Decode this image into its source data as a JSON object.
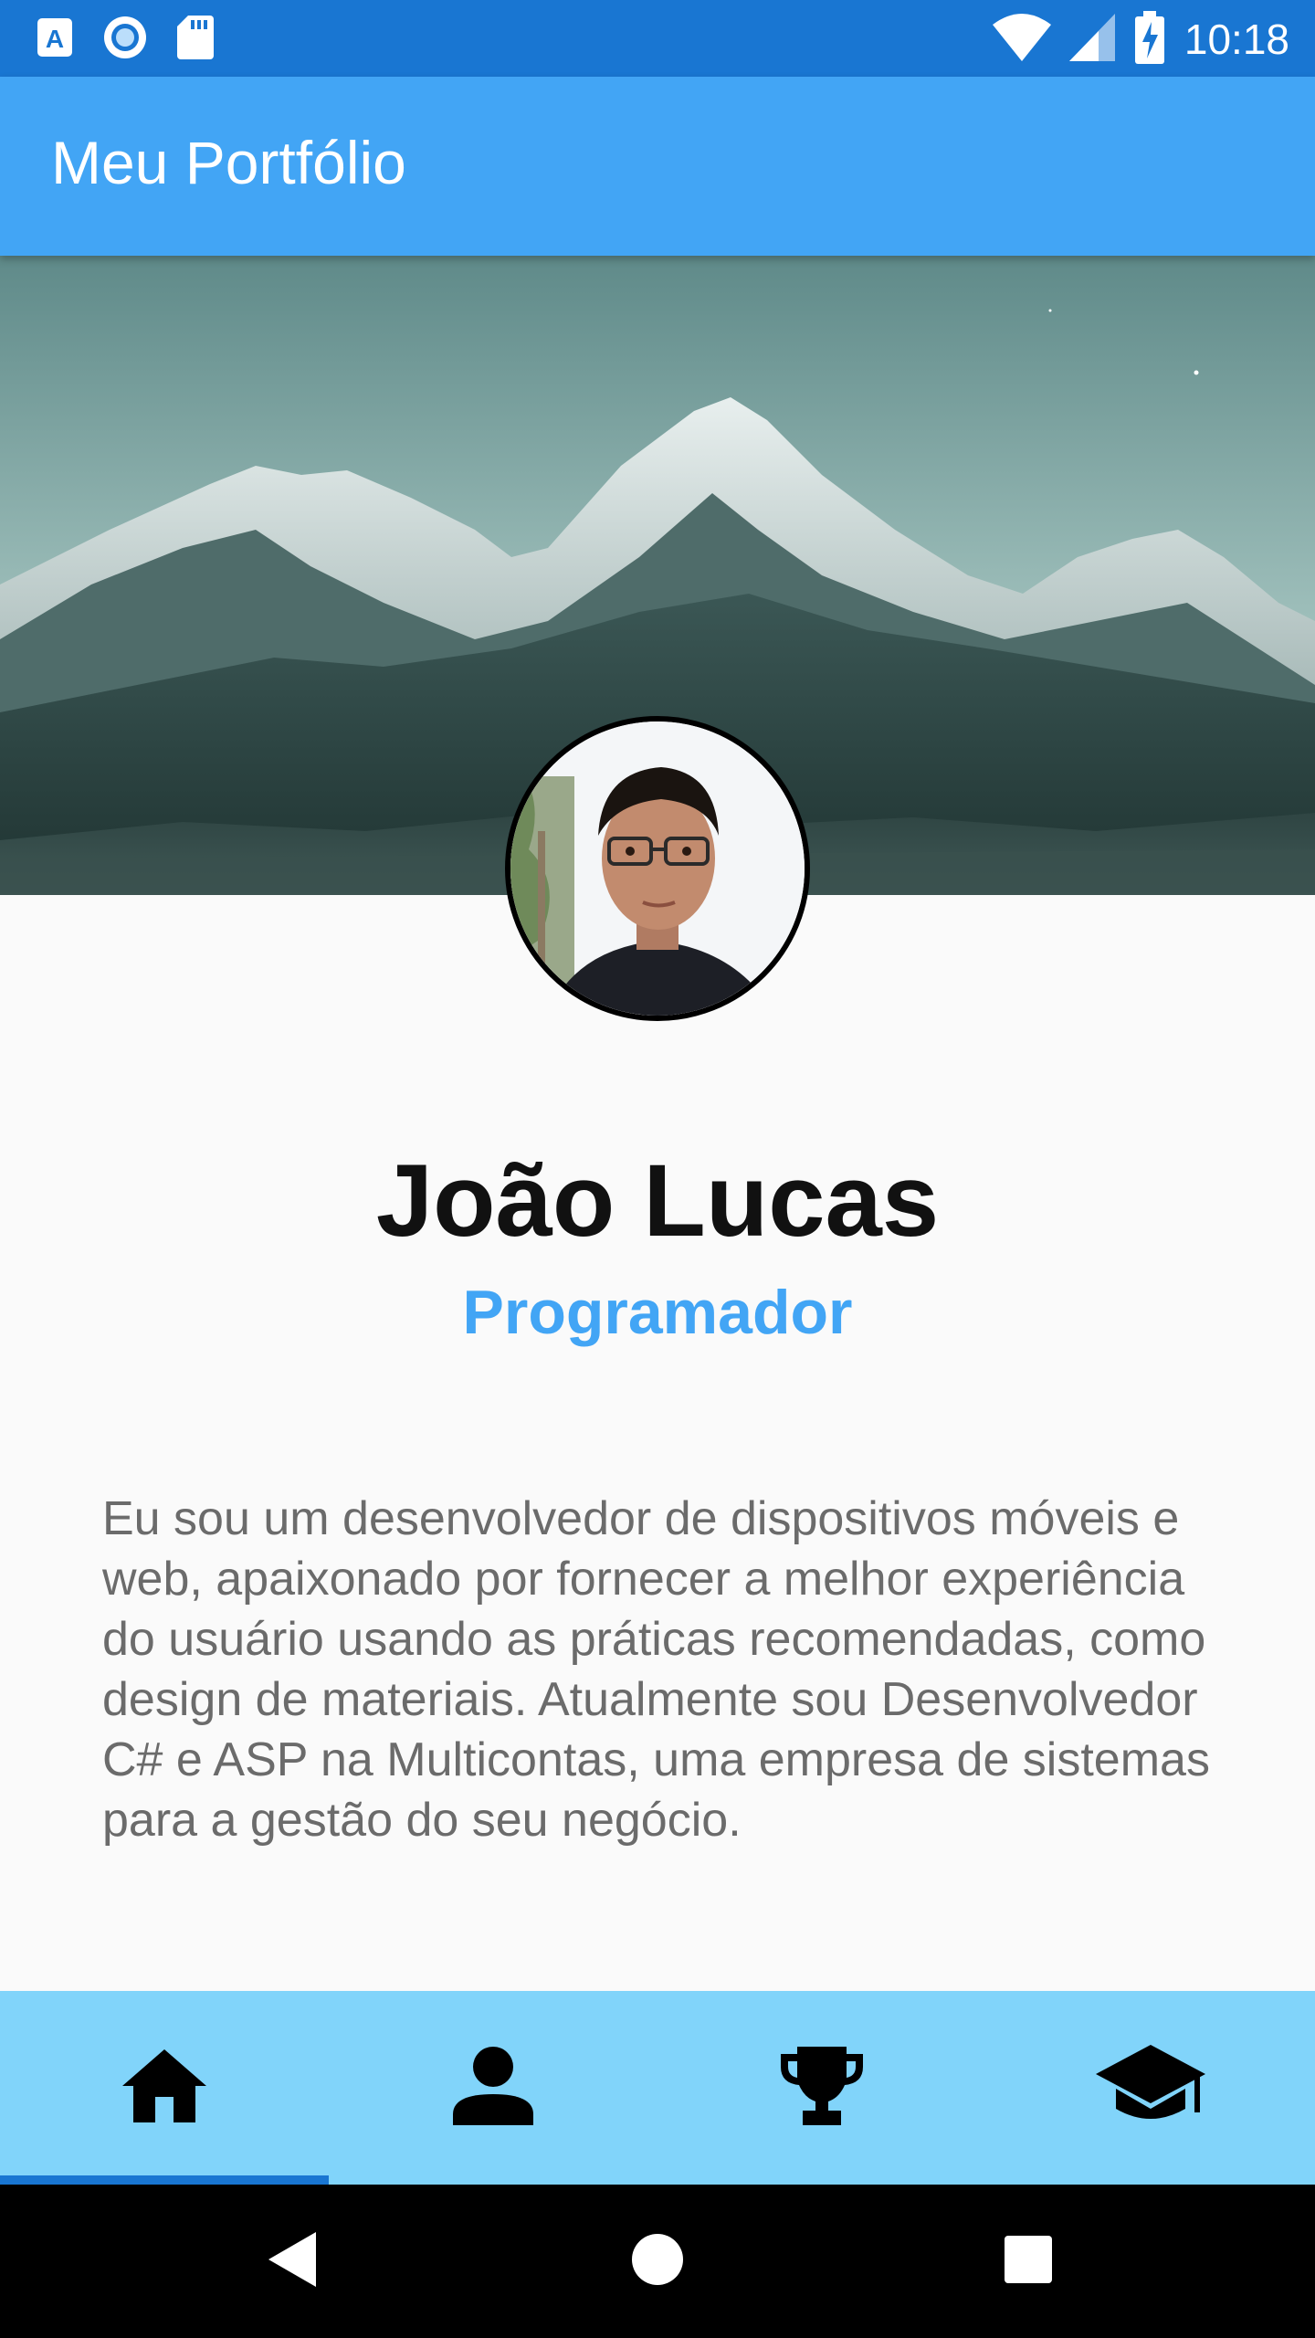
{
  "status_bar": {
    "time": "10:18",
    "background": "#1976d2",
    "left_icons": [
      "app-store-icon",
      "circle-notification-icon",
      "sd-card-icon"
    ],
    "right_icons": [
      "wifi-icon",
      "cellular-signal-icon",
      "battery-charging-icon"
    ]
  },
  "app_bar": {
    "title": "Meu Portfólio",
    "background": "#42a5f5"
  },
  "profile": {
    "name": "João Lucas",
    "role": "Programador",
    "bio": "Eu sou um desenvolvedor de dispositivos móveis e web, apaixonado por fornecer a melhor experiência do usuário usando as práticas recomendadas, como design de materiais. Atualmente sou Desenvolvedor C# e ASP na Multicontas, uma empresa de sistemas para a gestão do seu negócio.",
    "accent": "#42a5f5"
  },
  "bottom_nav": {
    "background": "#81d4fa",
    "indicator": "#1976d2",
    "items": [
      {
        "icon": "home-icon",
        "active": true
      },
      {
        "icon": "person-icon",
        "active": false
      },
      {
        "icon": "trophy-icon",
        "active": false
      },
      {
        "icon": "graduation-cap-icon",
        "active": false
      }
    ]
  },
  "system_nav": {
    "buttons": [
      "back-icon",
      "home-circle-icon",
      "recents-icon"
    ]
  }
}
